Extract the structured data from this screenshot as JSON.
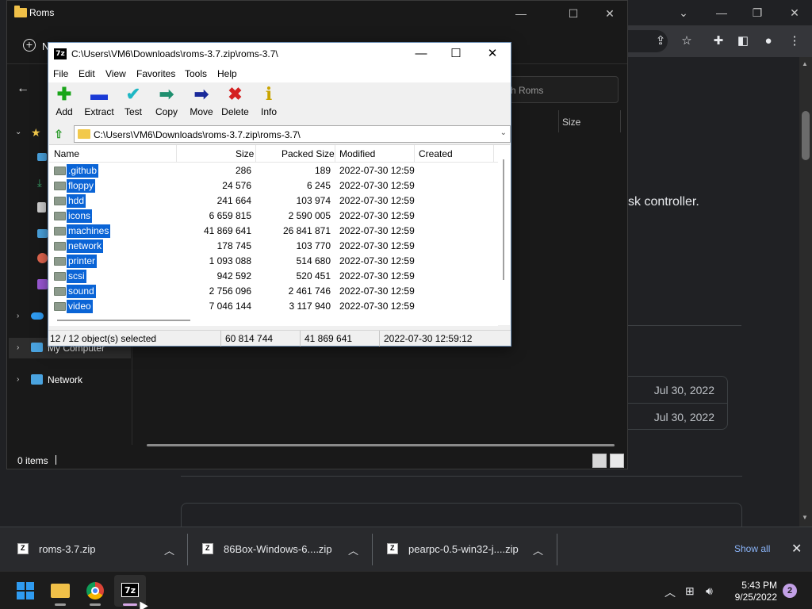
{
  "explorer": {
    "title": "Roms",
    "new_label": "N",
    "search_placeholder": "ch Roms",
    "column_size": "Size",
    "nav": {
      "my_computer": "My Computer",
      "network": "Network"
    },
    "status": "0 items"
  },
  "browser": {
    "page_text": "sk controller.",
    "dates": [
      "Jul 30, 2022",
      "Jul 30, 2022"
    ]
  },
  "sevenzip": {
    "title": "C:\\Users\\VM6\\Downloads\\roms-3.7.zip\\roms-3.7\\",
    "app_icon_text": "7z",
    "menu": [
      "File",
      "Edit",
      "View",
      "Favorites",
      "Tools",
      "Help"
    ],
    "toolbar": {
      "add": "Add",
      "extract": "Extract",
      "test": "Test",
      "copy": "Copy",
      "move": "Move",
      "delete": "Delete",
      "info": "Info"
    },
    "address": "C:\\Users\\VM6\\Downloads\\roms-3.7.zip\\roms-3.7\\",
    "columns": {
      "name": "Name",
      "size": "Size",
      "packed": "Packed Size",
      "modified": "Modified",
      "created": "Created"
    },
    "rows": [
      {
        "name": ".github",
        "size": "286",
        "packed": "189",
        "modified": "2022-07-30 12:59"
      },
      {
        "name": "floppy",
        "size": "24 576",
        "packed": "6 245",
        "modified": "2022-07-30 12:59"
      },
      {
        "name": "hdd",
        "size": "241 664",
        "packed": "103 974",
        "modified": "2022-07-30 12:59"
      },
      {
        "name": "icons",
        "size": "6 659 815",
        "packed": "2 590 005",
        "modified": "2022-07-30 12:59"
      },
      {
        "name": "machines",
        "size": "41 869 641",
        "packed": "26 841 871",
        "modified": "2022-07-30 12:59"
      },
      {
        "name": "network",
        "size": "178 745",
        "packed": "103 770",
        "modified": "2022-07-30 12:59"
      },
      {
        "name": "printer",
        "size": "1 093 088",
        "packed": "514 680",
        "modified": "2022-07-30 12:59"
      },
      {
        "name": "scsi",
        "size": "942 592",
        "packed": "520 451",
        "modified": "2022-07-30 12:59"
      },
      {
        "name": "sound",
        "size": "2 756 096",
        "packed": "2 461 746",
        "modified": "2022-07-30 12:59"
      },
      {
        "name": "video",
        "size": "7 046 144",
        "packed": "3 117 940",
        "modified": "2022-07-30 12:59"
      }
    ],
    "status": {
      "selection": "12 / 12 object(s) selected",
      "total_size": "60 814 744",
      "packed_size": "41 869 641",
      "modified": "2022-07-30 12:59:12"
    }
  },
  "downloads": {
    "items": [
      {
        "name": "roms-3.7.zip"
      },
      {
        "name": "86Box-Windows-6....zip"
      },
      {
        "name": "pearpc-0.5-win32-j....zip"
      }
    ],
    "show_all": "Show all"
  },
  "taskbar": {
    "time": "5:43 PM",
    "date": "9/25/2022",
    "notifications": "2",
    "sevenzip_label": "7z"
  },
  "colors": {
    "selection": "#0a64d6",
    "link": "#8ab4f8",
    "badge": "#c2a0e6"
  }
}
